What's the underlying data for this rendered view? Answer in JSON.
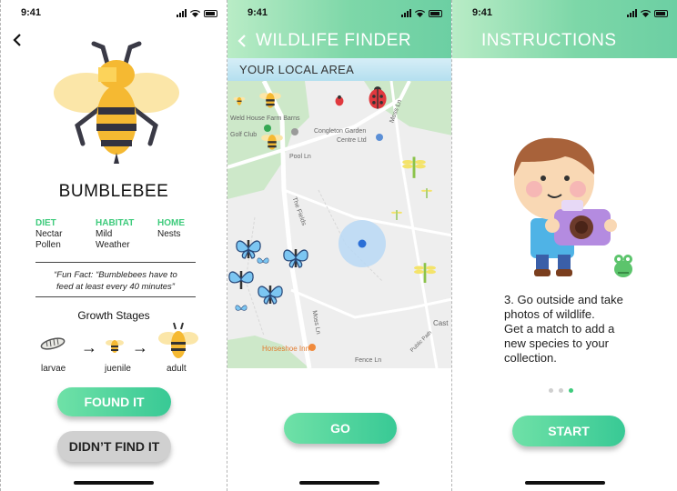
{
  "status": {
    "time": "9:41"
  },
  "screen1": {
    "back_icon": "chevron-left-icon",
    "name": "BUMBLEBEE",
    "diet": {
      "label": "DIET",
      "values": [
        "Nectar",
        "Pollen"
      ]
    },
    "habitat": {
      "label": "HABITAT",
      "values": [
        "Mild",
        "Weather"
      ]
    },
    "home": {
      "label": "HOME",
      "values": [
        "Nests"
      ]
    },
    "fun_fact_line1": "“Fun Fact: “Bumblebees have to",
    "fun_fact_line2": "feed at least every 40 minutes”",
    "growth_title": "Growth Stages",
    "stages": [
      "larvae",
      "juenile",
      "adult"
    ],
    "found_button": "FOUND IT",
    "not_found_button": "DIDN’T FIND IT"
  },
  "screen2": {
    "title": "WILDLIFE FINDER",
    "subtitle": "YOUR LOCAL AREA",
    "map_labels": {
      "weld_house": "Weld House Farm Barns",
      "golf_club": "Golf Club",
      "congleton": "Congleton Garden",
      "congleton2": "Centre Ltd",
      "pool_ln": "Pool Ln",
      "the_fields": "The Fields",
      "moss_ln": "Moss Ln",
      "moss_ln2": "Moss Ln",
      "horseshoe": "Horseshoe Inn",
      "cast": "Cast",
      "fence_ln": "Fence Ln",
      "public_path": "Public Path"
    },
    "go_button": "GO"
  },
  "screen3": {
    "title": "INSTRUCTIONS",
    "text_line1": "3. Go outside and take",
    "text_line2": "photos of wildlife.",
    "text_line3": "Get a match to add a",
    "text_line4": "new species to your",
    "text_line5": "collection.",
    "start_button": "START"
  },
  "colors": {
    "accent_green": "#3ecb7c",
    "header_green": "#7dd7a8",
    "map_green": "#cde8c9",
    "water_blue": "#b4dfef"
  }
}
